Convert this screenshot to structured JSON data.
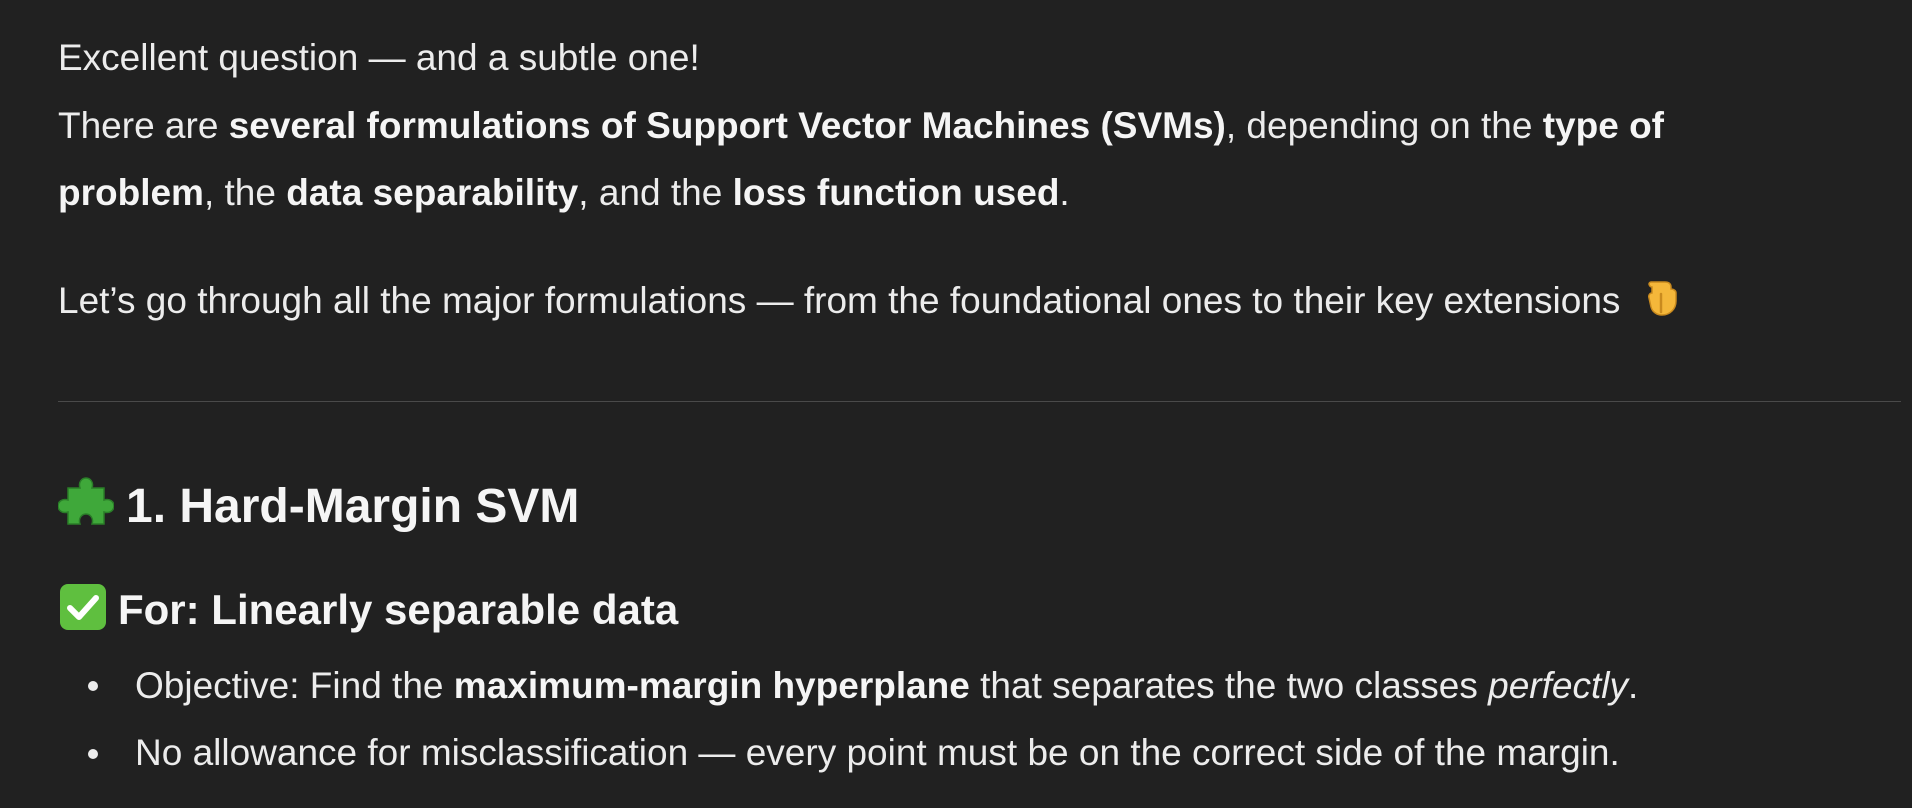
{
  "intro": {
    "line1": "Excellent question — and a subtle one!",
    "p2_a": "There are ",
    "p2_b": "several formulations of Support Vector Machines (SVMs)",
    "p2_c": ", depending on the ",
    "p2_d": "type of",
    "p3_a": "problem",
    "p3_b": ", the ",
    "p3_c": "data separability",
    "p3_d": ", and the ",
    "p3_e": "loss function used",
    "p3_f": ".",
    "line4": "Let’s go through all the major formulations — from the foundational ones to their key extensions",
    "line4_icon": "pointing-down-hand-icon"
  },
  "section1": {
    "icon": "puzzle-piece-icon",
    "title": "1. Hard-Margin SVM",
    "subheading_icon": "check-mark-icon",
    "subheading": "For: Linearly separable data",
    "bullets": {
      "b1_a": "Objective: Find the ",
      "b1_b": "maximum-margin hyperplane",
      "b1_c": " that separates the two classes ",
      "b1_d": "perfectly",
      "b1_e": ".",
      "b2": "No allowance for misclassification — every point must be on the correct side of the margin."
    }
  },
  "colors": {
    "background": "#212121",
    "text": "#ececec",
    "divider": "#4a4a4a",
    "check_green": "#5fbf3f",
    "puzzle_green": "#3fa83a",
    "hand_yellow": "#f4b73a"
  }
}
